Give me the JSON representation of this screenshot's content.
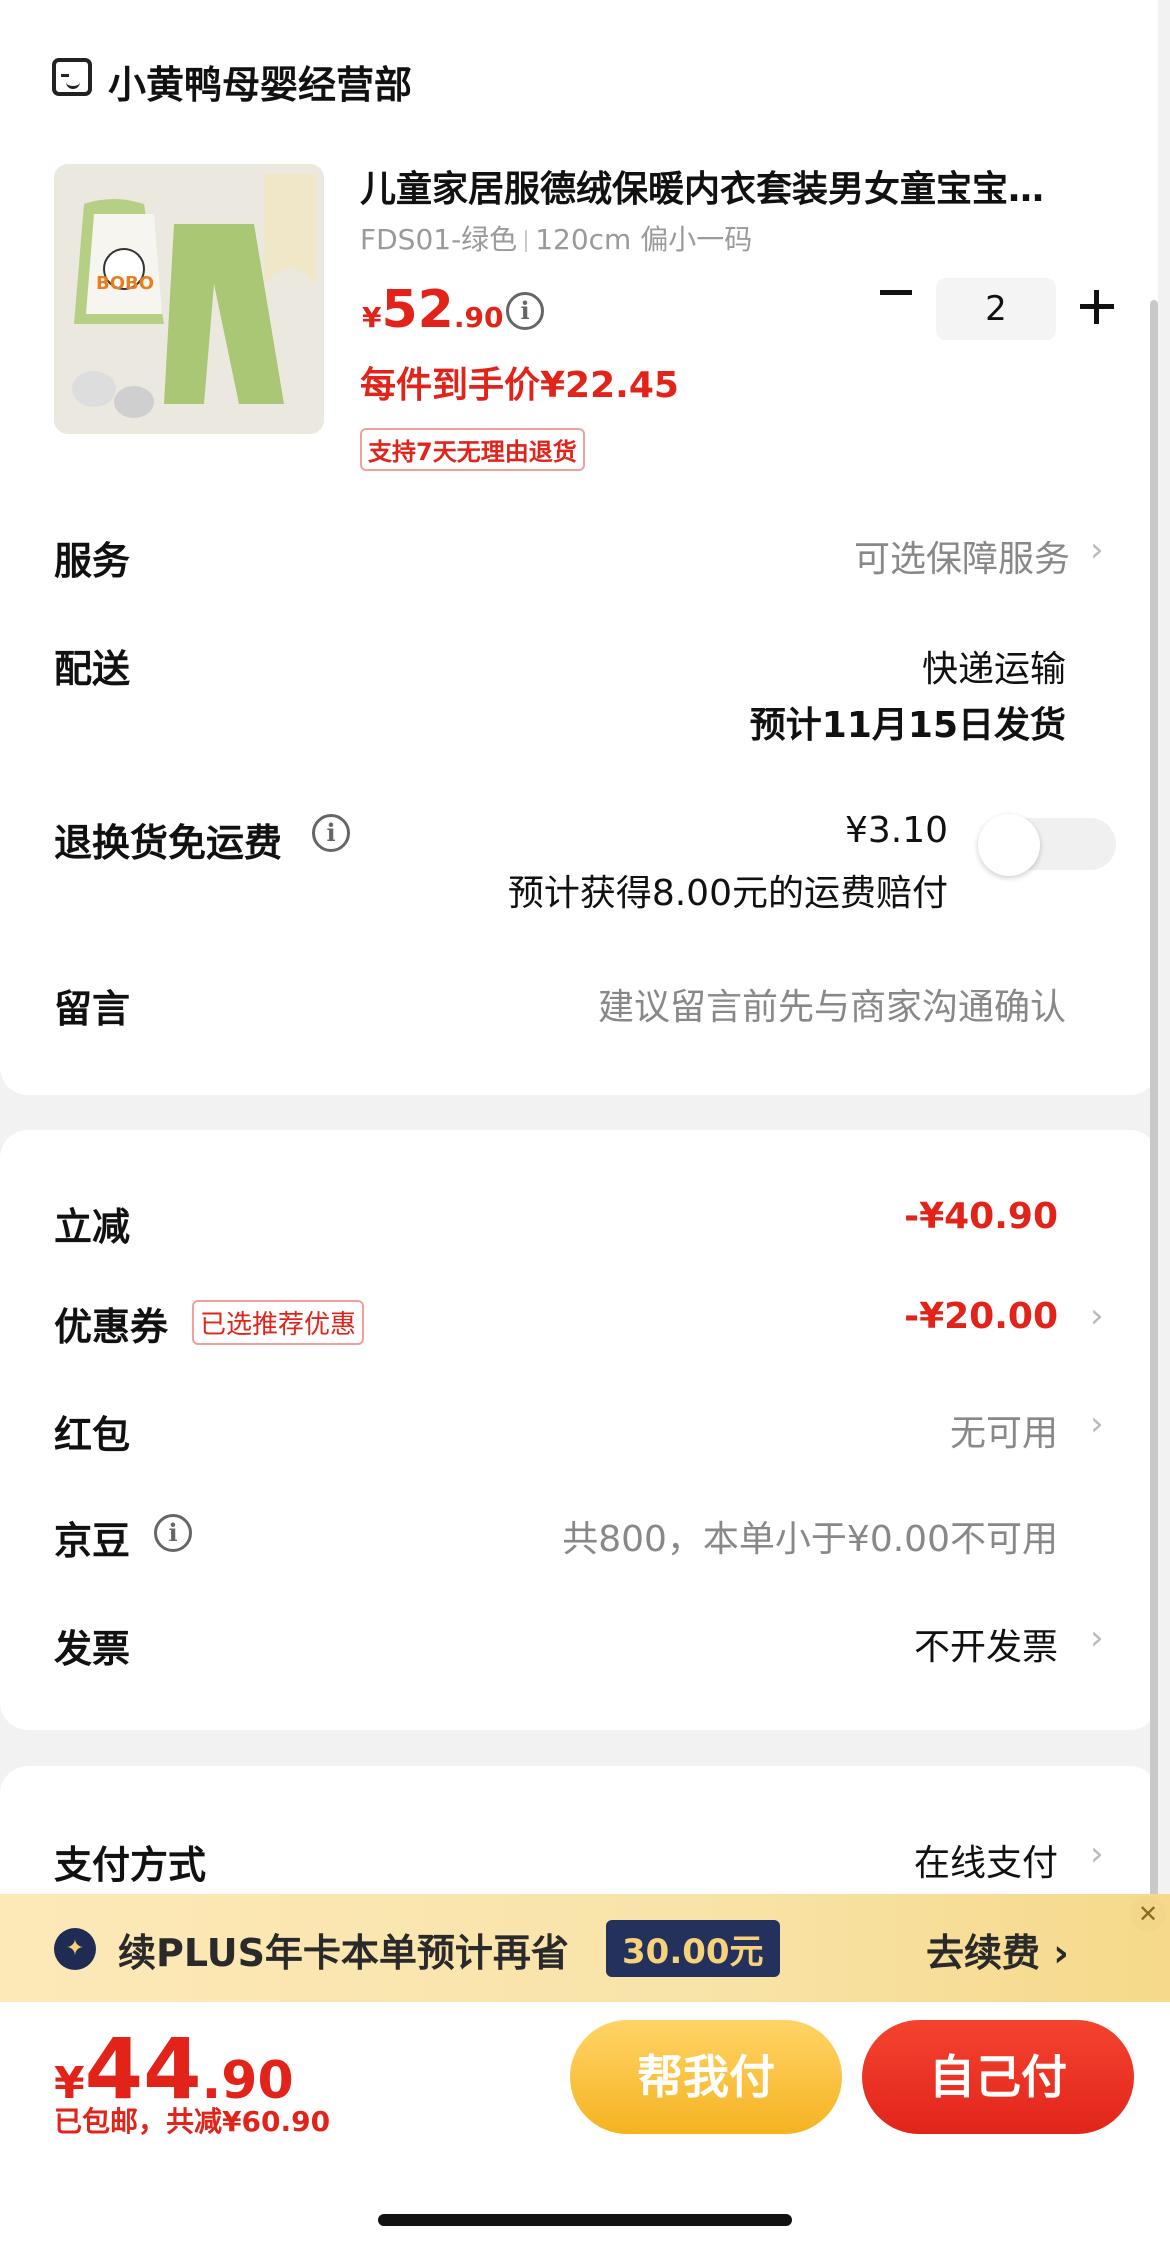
{
  "shop": {
    "name": "小黄鸭母婴经营部",
    "icon": "store-icon"
  },
  "product": {
    "title": "儿童家居服德绒保暖内衣套装男女童宝宝…",
    "spec_code": "FDS01-绿色",
    "spec_size": "120cm 偏小一码",
    "price_currency": "¥",
    "price_int": "52",
    "price_dec": ".90",
    "each_price": "每件到手价¥22.45",
    "return_badge": "支持7天无理由退货",
    "quantity": "2"
  },
  "rows": {
    "service_label": "服务",
    "service_value": "可选保障服务",
    "delivery_label": "配送",
    "delivery_value1": "快递运输",
    "delivery_value2": "预计11月15日发货",
    "freight_label": "退换货免运费",
    "freight_price": "¥3.10",
    "freight_note": "预计获得8.00元的运费赔付",
    "message_label": "留言",
    "message_placeholder": "建议留言前先与商家沟通确认"
  },
  "discounts": {
    "instant_label": "立减",
    "instant_value": "-¥40.90",
    "coupon_label": "优惠券",
    "coupon_badge": "已选推荐优惠",
    "coupon_value": "-¥20.00",
    "redpacket_label": "红包",
    "redpacket_value": "无可用",
    "jdbean_label": "京豆",
    "jdbean_value": "共800，本单小于¥0.00不可用",
    "invoice_label": "发票",
    "invoice_value": "不开发票"
  },
  "payment": {
    "label": "支付方式",
    "value": "在线支付"
  },
  "plus": {
    "text": "续PLUS年卡本单预计再省",
    "amount": "30.00元",
    "action": "去续费 ›",
    "close": "✕"
  },
  "footer": {
    "total_currency": "¥",
    "total_int": "44",
    "total_dec": ".90",
    "total_sub": "已包邮，共减¥60.90",
    "help_pay": "帮我付",
    "self_pay": "自己付"
  },
  "colors": {
    "accent_red": "#e2231a",
    "gold": "#f5b322"
  }
}
